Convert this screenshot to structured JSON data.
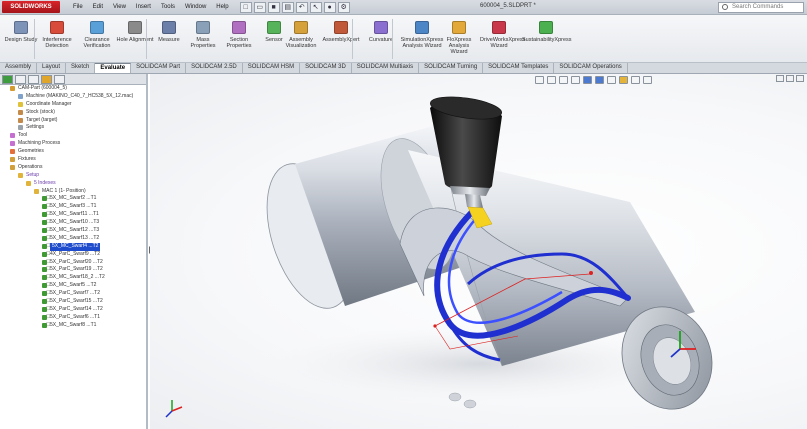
{
  "app": {
    "brand": "SOLIDWORKS",
    "document_title": "600004_5.SLDPRT *",
    "menus": [
      "File",
      "Edit",
      "View",
      "Insert",
      "Tools",
      "Window",
      "Help"
    ],
    "search_placeholder": "Search Commands"
  },
  "ribbon": [
    {
      "label": "Design Study",
      "icon": "design-study-icon",
      "color": "#7d93b8"
    },
    {
      "label": "Interference Detection",
      "icon": "interference-icon",
      "color": "#d84c3c"
    },
    {
      "label": "Clearance Verification",
      "icon": "clearance-icon",
      "color": "#5aa0d8"
    },
    {
      "label": "Hole Alignment",
      "icon": "hole-icon",
      "color": "#8a8a8a"
    },
    {
      "label": "Measure",
      "icon": "measure-icon",
      "color": "#6b7fa8"
    },
    {
      "label": "Mass Properties",
      "icon": "mass-icon",
      "color": "#8aa0b8"
    },
    {
      "label": "Section Properties",
      "icon": "section-icon",
      "color": "#b06fc0"
    },
    {
      "label": "Sensor",
      "icon": "sensor-icon",
      "color": "#57b35a"
    },
    {
      "label": "Assembly Visualization",
      "icon": "assembly-vis-icon",
      "color": "#d5a13b"
    },
    {
      "label": "AssemblyXpert",
      "icon": "assembly-xpert-icon",
      "color": "#c0583a"
    },
    {
      "label": "Curvature",
      "icon": "curvature-icon",
      "color": "#8a6fd0"
    },
    {
      "label": "SimulationXpress Analysis Wizard",
      "icon": "simxpress-icon",
      "color": "#4d86c7"
    },
    {
      "label": "FloXpress Analysis Wizard",
      "icon": "floxpress-icon",
      "color": "#e2a83a"
    },
    {
      "label": "DriveWorksXpress Wizard",
      "icon": "driveworks-icon",
      "color": "#c9384a"
    },
    {
      "label": "SustainabilityXpress",
      "icon": "sustain-icon",
      "color": "#4bb04f"
    }
  ],
  "command_tabs": [
    {
      "label": "Assembly",
      "active": false
    },
    {
      "label": "Layout",
      "active": false
    },
    {
      "label": "Sketch",
      "active": false
    },
    {
      "label": "Evaluate",
      "active": true
    },
    {
      "label": "SOLIDCAM Part",
      "active": false
    },
    {
      "label": "SOLIDCAM 2.5D",
      "active": false
    },
    {
      "label": "SOLIDCAM HSM",
      "active": false
    },
    {
      "label": "SOLIDCAM 3D",
      "active": false
    },
    {
      "label": "SOLIDCAM Multiaxis",
      "active": false
    },
    {
      "label": "SOLIDCAM Turning",
      "active": false
    },
    {
      "label": "SOLIDCAM Templates",
      "active": false
    },
    {
      "label": "SOLIDCAM Operations",
      "active": false
    }
  ],
  "tree": [
    {
      "label": "CAM-Part (600004_5)",
      "indent": 1,
      "icon": "folder-icon",
      "color": "#d59b2f"
    },
    {
      "label": "Machine (MAKINO_C40_7_HC538_5X_12.mac)",
      "indent": 2,
      "icon": "machine-icon",
      "color": "#7ea2c9"
    },
    {
      "label": "Coordinate Manager",
      "indent": 2,
      "icon": "coordinate-icon",
      "color": "#e0c13a"
    },
    {
      "label": "Stock (stock)",
      "indent": 2,
      "icon": "stock-icon",
      "color": "#c48a4a"
    },
    {
      "label": "Target (target)",
      "indent": 2,
      "icon": "target-icon",
      "color": "#c48a4a"
    },
    {
      "label": "Settings",
      "indent": 2,
      "icon": "settings-icon",
      "color": "#9aa2aa"
    },
    {
      "label": "Tool",
      "indent": 1,
      "icon": "tool-icon",
      "color": "#c56fd0"
    },
    {
      "label": "Machining Process",
      "indent": 1,
      "icon": "process-icon",
      "color": "#c56fd0"
    },
    {
      "label": "Geometries",
      "indent": 1,
      "icon": "geometry-icon",
      "color": "#e46f3a"
    },
    {
      "label": "Fixtures",
      "indent": 1,
      "icon": "fixture-icon",
      "color": "#d2a03a"
    },
    {
      "label": "Operations",
      "indent": 1,
      "icon": "operations-icon",
      "color": "#d2a03a"
    },
    {
      "label": "Setup",
      "indent": 2,
      "icon": "setup-icon",
      "color": "#e0b33a",
      "target": true
    },
    {
      "label": "5 Indexes",
      "indent": 3,
      "icon": "index-icon",
      "color": "#e0b33a",
      "target": true
    },
    {
      "label": "MAC 1 (1- Position)",
      "indent": 4,
      "icon": "mac-icon",
      "color": "#e0b33a"
    },
    {
      "label": "5X_MC_Swarf2 ...T1",
      "indent": 5,
      "icon": "op-icon",
      "color": "#3f9a34",
      "check": true
    },
    {
      "label": "5X_MC_Swarf3 ...T1",
      "indent": 5,
      "icon": "op-icon",
      "color": "#3f9a34",
      "check": true
    },
    {
      "label": "5X_MC_Swarf11 ...T1",
      "indent": 5,
      "icon": "op-icon",
      "color": "#3f9a34",
      "check": true
    },
    {
      "label": "5X_MC_Swarf10 ...T3",
      "indent": 5,
      "icon": "op-icon",
      "color": "#3f9a34",
      "check": true
    },
    {
      "label": "5X_MC_Swarf12 ...T3",
      "indent": 5,
      "icon": "op-icon",
      "color": "#3f9a34",
      "check": true
    },
    {
      "label": "5X_MC_Swarf13 ...T2",
      "indent": 5,
      "icon": "op-icon",
      "color": "#3f9a34",
      "check": true
    },
    {
      "label": "5X_MC_Swarf4 ...T2",
      "indent": 5,
      "icon": "op-icon",
      "color": "#3f9a34",
      "check": true,
      "selected": true
    },
    {
      "label": "4X_ParC_Swarf9 ...T2",
      "indent": 5,
      "icon": "op-icon",
      "color": "#3f9a34",
      "check": true
    },
    {
      "label": "5X_ParC_Swarf20 ...T2",
      "indent": 5,
      "icon": "op-icon",
      "color": "#3f9a34",
      "check": true
    },
    {
      "label": "5X_ParC_Swarf19 ...T2",
      "indent": 5,
      "icon": "op-icon",
      "color": "#3f9a34",
      "check": true
    },
    {
      "label": "5X_MC_Swarf18_2 ...T2",
      "indent": 5,
      "icon": "op-icon",
      "color": "#3f9a34",
      "check": true
    },
    {
      "label": "5X_MC_Swarf5 ...T2",
      "indent": 5,
      "icon": "op-icon",
      "color": "#3f9a34",
      "check": true
    },
    {
      "label": "5X_ParC_Swarf7 ...T2",
      "indent": 5,
      "icon": "op-icon",
      "color": "#3f9a34",
      "check": true
    },
    {
      "label": "5X_ParC_Swarf15 ...T2",
      "indent": 5,
      "icon": "op-icon",
      "color": "#3f9a34",
      "check": true
    },
    {
      "label": "5X_ParC_Swarf14 ...T2",
      "indent": 5,
      "icon": "op-icon",
      "color": "#3f9a34",
      "check": true
    },
    {
      "label": "5X_ParC_Swarf6 ...T1",
      "indent": 5,
      "icon": "op-icon",
      "color": "#3f9a34",
      "check": true
    },
    {
      "label": "5X_MC_Swarf8 ...T1",
      "indent": 5,
      "icon": "op-icon",
      "color": "#3f9a34",
      "check": true
    }
  ],
  "colors": {
    "toolpath": "#1f2fd0",
    "tool_holder": "#1b1b1b",
    "tool_tip": "#f4d21f",
    "part": "#c6ccd6",
    "selection": "#1e4ccc"
  }
}
